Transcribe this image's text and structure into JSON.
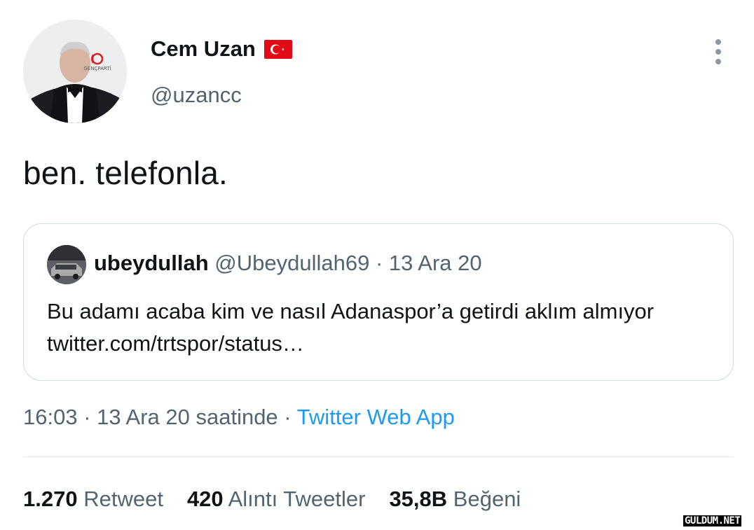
{
  "tweet": {
    "author_name": "Cem Uzan",
    "author_handle": "@uzancc",
    "flag_icon": "turkey-flag-icon",
    "text": "ben. telefonla.",
    "time": "16:03",
    "date_phrase": "13 Ara 20 saatinde",
    "source": "Twitter Web App",
    "separator": " · "
  },
  "quoted": {
    "name": "ubeydullah",
    "handle": "@Ubeydullah69",
    "date": "13 Ara 20",
    "separator": " · ",
    "text": "Bu adamı acaba kim ve nasıl Adanaspor’a getirdi aklım almıyor twitter.com/trtspor/status…"
  },
  "stats": {
    "retweets_count": "1.270",
    "retweets_label": "Retweet",
    "quotes_count": "420",
    "quotes_label": "Alıntı Tweetler",
    "likes_count": "35,8B",
    "likes_label": "Beğeni"
  },
  "avatar_text": {
    "logo": "GENÇPARTİ"
  },
  "watermark": "GULDUM.NET",
  "colors": {
    "text_primary": "#0f1419",
    "text_secondary": "#536471",
    "link": "#1d9bf0",
    "border": "#cfd9de",
    "flag_red": "#e30a17"
  }
}
